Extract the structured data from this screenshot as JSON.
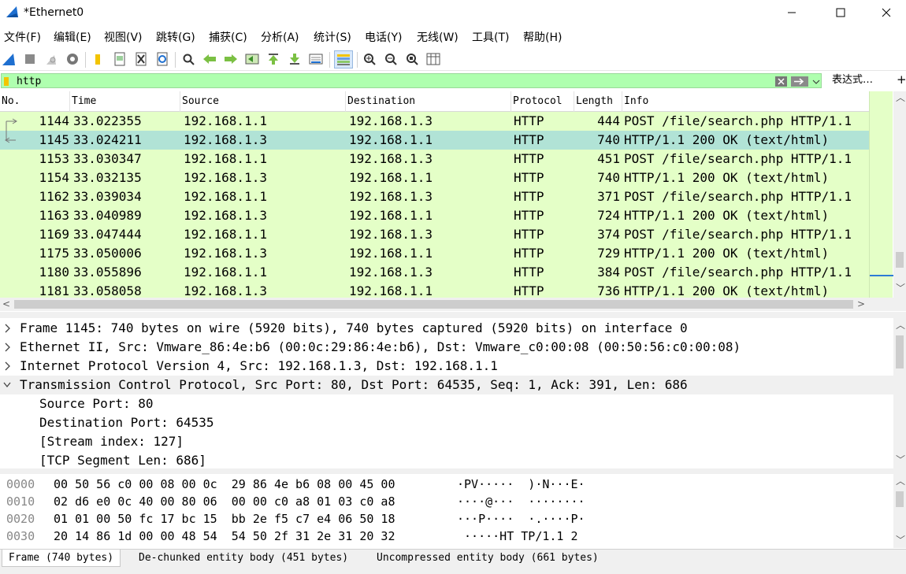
{
  "window": {
    "title": "*Ethernet0"
  },
  "menu": [
    "文件(F)",
    "编辑(E)",
    "视图(V)",
    "跳转(G)",
    "捕获(C)",
    "分析(A)",
    "统计(S)",
    "电话(Y)",
    "无线(W)",
    "工具(T)",
    "帮助(H)"
  ],
  "filter": {
    "value": "http",
    "expression_label": "表达式…",
    "add_label": "+"
  },
  "columns": {
    "no": "No.",
    "time": "Time",
    "source": "Source",
    "destination": "Destination",
    "protocol": "Protocol",
    "length": "Length",
    "info": "Info"
  },
  "packets": [
    {
      "no": "1144",
      "time": "33.022355",
      "source": "192.168.1.1",
      "destination": "192.168.1.3",
      "protocol": "HTTP",
      "length": "444",
      "info": "POST /file/search.php HTTP/1.1"
    },
    {
      "no": "1145",
      "time": "33.024211",
      "source": "192.168.1.3",
      "destination": "192.168.1.1",
      "protocol": "HTTP",
      "length": "740",
      "info": "HTTP/1.1 200 OK  (text/html)"
    },
    {
      "no": "1153",
      "time": "33.030347",
      "source": "192.168.1.1",
      "destination": "192.168.1.3",
      "protocol": "HTTP",
      "length": "451",
      "info": "POST /file/search.php HTTP/1.1"
    },
    {
      "no": "1154",
      "time": "33.032135",
      "source": "192.168.1.3",
      "destination": "192.168.1.1",
      "protocol": "HTTP",
      "length": "740",
      "info": "HTTP/1.1 200 OK  (text/html)"
    },
    {
      "no": "1162",
      "time": "33.039034",
      "source": "192.168.1.1",
      "destination": "192.168.1.3",
      "protocol": "HTTP",
      "length": "371",
      "info": "POST /file/search.php HTTP/1.1"
    },
    {
      "no": "1163",
      "time": "33.040989",
      "source": "192.168.1.3",
      "destination": "192.168.1.1",
      "protocol": "HTTP",
      "length": "724",
      "info": "HTTP/1.1 200 OK  (text/html)"
    },
    {
      "no": "1169",
      "time": "33.047444",
      "source": "192.168.1.1",
      "destination": "192.168.1.3",
      "protocol": "HTTP",
      "length": "374",
      "info": "POST /file/search.php HTTP/1.1"
    },
    {
      "no": "1175",
      "time": "33.050006",
      "source": "192.168.1.3",
      "destination": "192.168.1.1",
      "protocol": "HTTP",
      "length": "729",
      "info": "HTTP/1.1 200 OK  (text/html)"
    },
    {
      "no": "1180",
      "time": "33.055896",
      "source": "192.168.1.1",
      "destination": "192.168.1.3",
      "protocol": "HTTP",
      "length": "384",
      "info": "POST /file/search.php HTTP/1.1"
    },
    {
      "no": "1181",
      "time": "33.058058",
      "source": "192.168.1.3",
      "destination": "192.168.1.1",
      "protocol": "HTTP",
      "length": "736",
      "info": "HTTP/1.1 200 OK  (text/html)"
    }
  ],
  "selected_packet": "1145",
  "details": [
    {
      "text": "Frame 1145: 740 bytes on wire (5920 bits), 740 bytes captured (5920 bits) on interface 0",
      "toggle": "collapsed",
      "indent": 0
    },
    {
      "text": "Ethernet II, Src: Vmware_86:4e:b6 (00:0c:29:86:4e:b6), Dst: Vmware_c0:00:08 (00:50:56:c0:00:08)",
      "toggle": "collapsed",
      "indent": 0
    },
    {
      "text": "Internet Protocol Version 4, Src: 192.168.1.3, Dst: 192.168.1.1",
      "toggle": "collapsed",
      "indent": 0
    },
    {
      "text": "Transmission Control Protocol, Src Port: 80, Dst Port: 64535, Seq: 1, Ack: 391, Len: 686",
      "toggle": "expanded",
      "indent": 0
    },
    {
      "text": "Source Port: 80",
      "toggle": "none",
      "indent": 1
    },
    {
      "text": "Destination Port: 64535",
      "toggle": "none",
      "indent": 1
    },
    {
      "text": "[Stream index: 127]",
      "toggle": "none",
      "indent": 1
    },
    {
      "text": "[TCP Segment Len: 686]",
      "toggle": "none",
      "indent": 1
    }
  ],
  "bytes": [
    {
      "offset": "0000",
      "hex": "00 50 56 c0 00 08 00 0c  29 86 4e b6 08 00 45 00",
      "ascii": "·PV·····  )·N···E·"
    },
    {
      "offset": "0010",
      "hex": "02 d6 e0 0c 40 00 80 06  00 00 c0 a8 01 03 c0 a8",
      "ascii": "····@···  ········"
    },
    {
      "offset": "0020",
      "hex": "01 01 00 50 fc 17 bc 15  bb 2e f5 c7 e4 06 50 18",
      "ascii": "···P····  ·.····P·"
    },
    {
      "offset": "0030",
      "hex": "20 14 86 1d 00 00 48 54  54 50 2f 31 2e 31 20 32",
      "ascii": " ·····HT TP/1.1 2"
    }
  ],
  "bytes_tabs": [
    "Frame (740 bytes)",
    "De-chunked entity body (451 bytes)",
    "Uncompressed entity body (661 bytes)"
  ],
  "colors": {
    "http_row": "#e4ffc7",
    "selected_row": "#b1e3d6",
    "filter_ok": "#afffaf",
    "accent": "#1e6fd0"
  },
  "toolbar_icons": [
    "shark-fin-start-icon",
    "stop-icon",
    "restart-icon",
    "capture-options-icon",
    "open-icon",
    "file-icon",
    "close-file-icon",
    "reload-icon",
    "find-icon",
    "go-back-icon",
    "go-forward-icon",
    "go-to-packet-icon",
    "go-first-icon",
    "go-last-icon",
    "autoscroll-icon",
    "colorize-icon",
    "zoom-in-icon",
    "zoom-out-icon",
    "zoom-normal-icon",
    "resize-columns-icon"
  ]
}
